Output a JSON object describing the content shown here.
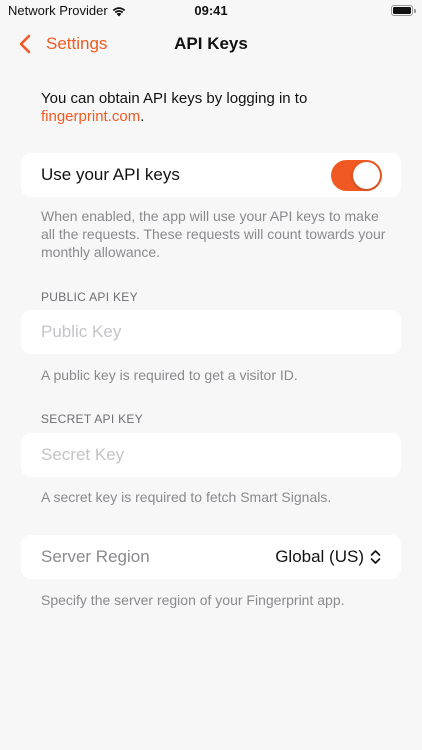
{
  "status_bar": {
    "carrier": "Network Provider",
    "time": "09:41",
    "icons": [
      "wifi-icon",
      "battery-icon"
    ]
  },
  "nav": {
    "back_label": "Settings",
    "back_icon": "chevron-left-icon",
    "title": "API Keys"
  },
  "intro": {
    "text": "You can obtain API keys by logging in to",
    "link": "fingerprint.com",
    "suffix": "."
  },
  "use_keys": {
    "label": "Use your API keys",
    "enabled": true,
    "footer": "When enabled, the app will use your API keys to make all the requests. These requests will count towards your monthly allowance."
  },
  "public_key": {
    "header": "PUBLIC API KEY",
    "value": "",
    "placeholder": "Public Key",
    "footer": "A public key is required to get a visitor ID."
  },
  "secret_key": {
    "header": "SECRET API KEY",
    "value": "",
    "placeholder": "Secret Key",
    "footer": "A secret key is required to fetch Smart Signals."
  },
  "server_region": {
    "label": "Server Region",
    "selected": "Global (US)",
    "icon": "chevron-up-down-icon",
    "footer": "Specify the server region of your Fingerprint app."
  },
  "colors": {
    "accent": "#f05a22",
    "background": "#f7f7f7",
    "card": "#ffffff",
    "secondary_text": "#8a8a8e"
  }
}
